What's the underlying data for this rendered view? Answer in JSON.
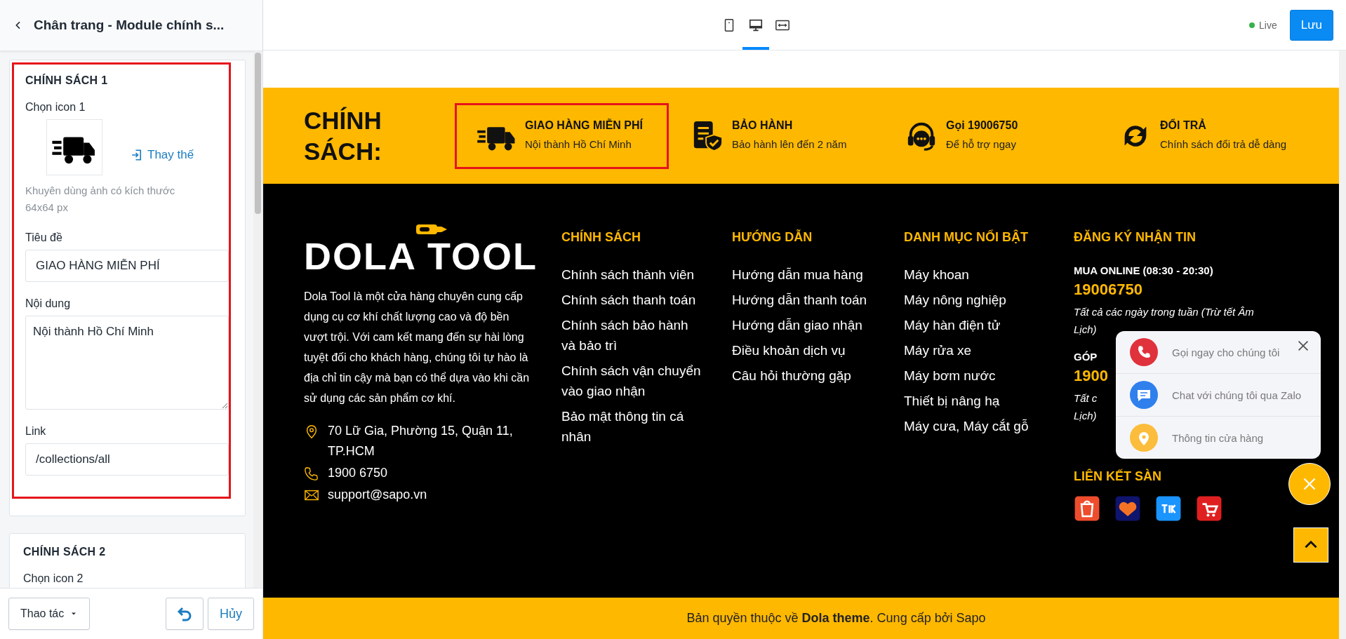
{
  "sidebar": {
    "title": "Chân trang - Module chính s...",
    "cards": [
      {
        "heading": "CHÍNH SÁCH 1",
        "highlighted": true,
        "image_label": "Chọn icon 1",
        "replace_link": "Thay thế",
        "hint": "Khuyên dùng ảnh có kích thước 64x64 px",
        "fields": [
          {
            "kind": "input",
            "label": "Tiêu đề",
            "value": "GIAO HÀNG MIỄN PHÍ"
          },
          {
            "kind": "textarea",
            "label": "Nội dung",
            "value": "Nội thành Hồ Chí Minh"
          },
          {
            "kind": "input",
            "label": "Link",
            "value": "/collections/all"
          }
        ]
      },
      {
        "heading": "CHÍNH SÁCH 2",
        "highlighted": false,
        "image_label": "Chọn icon 2"
      }
    ],
    "actions_button": "Thao tác",
    "cancel_button": "Hủy"
  },
  "toolbar": {
    "devices": [
      {
        "kind": "mobile",
        "selected": false
      },
      {
        "kind": "desktop",
        "selected": true
      },
      {
        "kind": "fullwidth",
        "selected": false
      }
    ],
    "status": "Live",
    "save_button": "Lưu"
  },
  "policy_band": {
    "title": "CHÍNH SÁCH:",
    "items": [
      {
        "kind": "truck",
        "title": "GIAO HÀNG MIỄN PHÍ",
        "text": "Nội thành Hồ Chí Minh",
        "highlighted": true
      },
      {
        "kind": "warranty",
        "title": "BẢO HÀNH",
        "text": "Bảo hành lên đến 2 năm",
        "highlighted": false
      },
      {
        "kind": "support",
        "title": "Gọi 19006750",
        "text": "Để hỗ trợ ngay",
        "highlighted": false
      },
      {
        "kind": "exchange",
        "title": "ĐỔI TRẢ",
        "text": "Chính sách đổi trả dễ dàng",
        "highlighted": false
      }
    ]
  },
  "footer": {
    "logo": "DOLA TOOL",
    "description": "Dola Tool là một cửa hàng chuyên cung cấp dụng cụ cơ khí chất lượng cao và độ bền vượt trội. Với cam kết mang đến sự hài lòng tuyệt đối cho khách hàng, chúng tôi tự hào là địa chỉ tin cậy mà bạn có thể dựa vào khi cần sử dụng các sản phẩm cơ khí.",
    "contacts": [
      {
        "kind": "address",
        "text": "70 Lữ Gia, Phường 15, Quận 11, TP.HCM"
      },
      {
        "kind": "phone",
        "text": "1900 6750"
      },
      {
        "kind": "email",
        "text": "support@sapo.vn"
      }
    ],
    "link_columns": [
      {
        "heading": "CHÍNH SÁCH",
        "links": [
          "Chính sách thành viên",
          "Chính sách thanh toán",
          "Chính sách bảo hành và bảo trì",
          "Chính sách vận chuyển vào giao nhận",
          "Bảo mật thông tin cá nhân"
        ]
      },
      {
        "heading": "HƯỚNG DẪN",
        "links": [
          "Hướng dẫn mua hàng",
          "Hướng dẫn thanh toán",
          "Hướng dẫn giao nhận",
          "Điều khoản dịch vụ",
          "Câu hỏi thường gặp"
        ]
      },
      {
        "heading": "DANH MỤC NỔI BẬT",
        "links": [
          "Máy khoan",
          "Máy nông nghiệp",
          "Máy hàn điện tử",
          "Máy rửa xe",
          "Máy bơm nước",
          "Thiết bị nâng hạ",
          "Máy cưa, Máy cắt gỗ"
        ]
      }
    ],
    "newsletter": {
      "heading": "ĐĂNG KÝ NHẬN TIN",
      "hotlines": [
        {
          "label": "MUA ONLINE (08:30 - 20:30)",
          "number": "19006750",
          "note_lines": [
            "Tất cả các ngày trong tuần (Trừ tết Âm",
            "Lịch)"
          ]
        },
        {
          "label": "GÓP",
          "number": "1900",
          "note_lines": [
            "Tất c",
            "Lịch)"
          ]
        }
      ],
      "marketplaces_heading": "LIÊN KẾT SÀN",
      "marketplaces": [
        {
          "kind": "shopee"
        },
        {
          "kind": "lazada"
        },
        {
          "kind": "tiki"
        },
        {
          "kind": "sendo"
        }
      ]
    }
  },
  "copyright": "Bản quyền thuộc về **Dola theme**. Cung cấp bởi Sapo",
  "contact_popup": {
    "items": [
      {
        "kind": "call",
        "label": "Gọi ngay cho chúng tôi"
      },
      {
        "kind": "zalo",
        "label": "Chat với chúng tôi qua Zalo"
      },
      {
        "kind": "store",
        "label": "Thông tin cửa hàng"
      }
    ]
  }
}
